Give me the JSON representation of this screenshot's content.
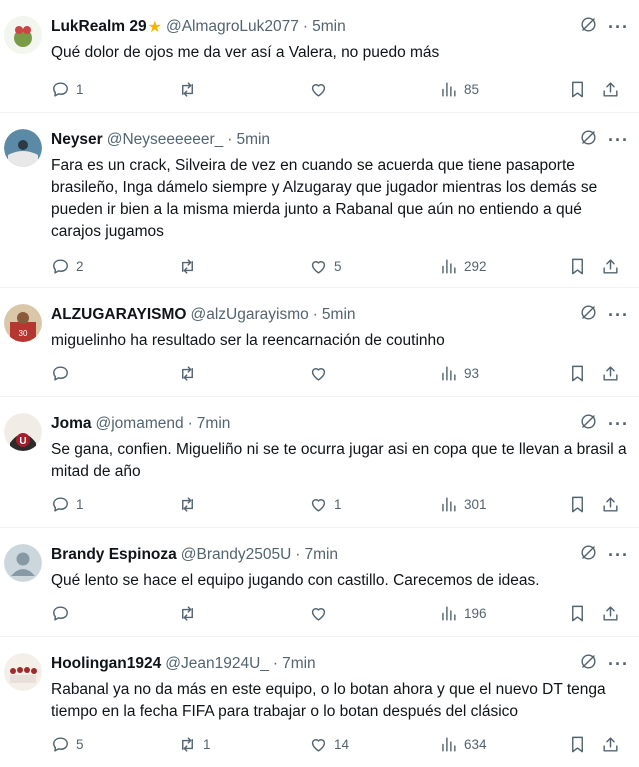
{
  "tweets": [
    {
      "name": "LukRealm 29",
      "star": "★",
      "handle": "@AlmagroLuk2077",
      "time": "5min",
      "text": "Qué dolor de ojos me da ver así a Valera, no puedo más",
      "replies": "1",
      "retweets": "",
      "likes": "",
      "views": "85",
      "avatar_color": "#6a8f3a"
    },
    {
      "name": "Neyser",
      "handle": "@Neyseeeeeer_",
      "time": "5min",
      "text": "Fara es un crack, Silveira de vez en cuando se acuerda que tiene pasaporte brasileño, Inga dámelo siempre y Alzugaray que jugador mientras los demás se pueden ir bien a la misma mierda junto a Rabanal que aún no entiendo a qué carajos jugamos",
      "replies": "2",
      "retweets": "",
      "likes": "5",
      "views": "292",
      "avatar_color": "#3d6e8a"
    },
    {
      "name": "ALZUGARAYISMO",
      "handle": "@alzUgarayismo",
      "time": "5min",
      "text": "miguelinho ha resultado ser la reencarnación de coutinho",
      "replies": "",
      "retweets": "",
      "likes": "",
      "views": "93",
      "avatar_color": "#b5372f"
    },
    {
      "name": "Joma",
      "handle": "@jomamend",
      "time": "7min",
      "text": "Se gana, confien. Migueliño ni se te ocurra jugar asi en copa que te llevan a brasil a mitad de año",
      "replies": "1",
      "retweets": "",
      "likes": "1",
      "views": "301",
      "avatar_color": "#2b2b2b",
      "avatar_letter": "U"
    },
    {
      "name": "Brandy Espinoza",
      "handle": "@Brandy2505U",
      "time": "7min",
      "text": "Qué lento se hace el equipo jugando con castillo. Carecemos de ideas.",
      "replies": "",
      "retweets": "",
      "likes": "",
      "views": "196",
      "avatar_color": "#ccd6dd"
    },
    {
      "name": "Hoolingan1924",
      "handle": "@Jean1924U_",
      "time": "7min",
      "text": "Rabanal ya no da más en este equipo, o lo botan ahora y que el nuevo DT tenga tiempo en la fecha FIFA para trabajar o lo botan después del clásico",
      "replies": "5",
      "retweets": "1",
      "likes": "14",
      "views": "634",
      "avatar_color": "#a02a2a"
    }
  ],
  "separator": "·",
  "more_glyph": "···",
  "colors": {
    "secondary_text": "#536471",
    "border": "#eff3f4",
    "star": "#f4b400"
  },
  "icons": [
    "grok-icon",
    "more-icon",
    "reply-icon",
    "retweet-icon",
    "like-icon",
    "views-icon",
    "bookmark-icon",
    "share-icon"
  ]
}
